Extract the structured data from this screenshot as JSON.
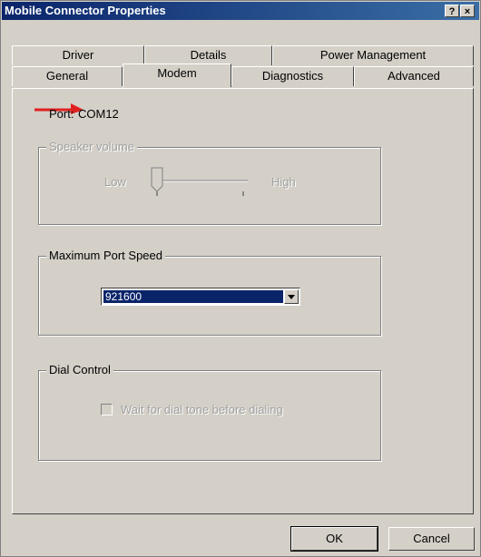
{
  "window": {
    "title": "Mobile Connector Properties",
    "help_label": "?",
    "close_label": "×"
  },
  "tabs": {
    "row1": [
      "Driver",
      "Details",
      "Power Management"
    ],
    "row2": [
      "General",
      "Modem",
      "Diagnostics",
      "Advanced"
    ],
    "active": "Modem"
  },
  "port": {
    "label": "Port:",
    "value": "COM12"
  },
  "speaker_volume": {
    "legend": "Speaker volume",
    "low_label": "Low",
    "high_label": "High",
    "level": 0.0,
    "enabled": false
  },
  "max_port_speed": {
    "legend": "Maximum Port Speed",
    "selected": "921600"
  },
  "dial_control": {
    "legend": "Dial Control",
    "checkbox_label": "Wait for dial tone before dialing",
    "checked": false,
    "enabled": false
  },
  "buttons": {
    "ok": "OK",
    "cancel": "Cancel"
  },
  "colors": {
    "annotation_arrow": "#e02020",
    "selection": "#0a246a",
    "face": "#d4d0c8"
  }
}
